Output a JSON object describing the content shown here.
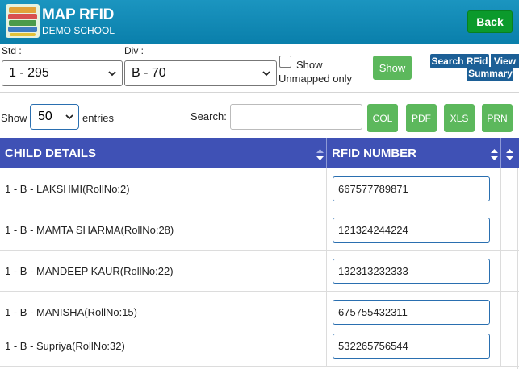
{
  "header": {
    "title": "MAP RFID",
    "subtitle": "DEMO SCHOOL",
    "back_label": "Back",
    "bg_color": "#0e8bb6"
  },
  "filters": {
    "std_label": "Std :",
    "std_value": "1 - 295",
    "div_label": "Div :",
    "div_value": "B - 70",
    "show_unmapped_line1": "Show",
    "show_unmapped_line2": "Unmapped only",
    "show_unmapped_checked": false,
    "show_button": "Show",
    "search_rfid_button": "Search RFid",
    "view_summary_line1": "View",
    "view_summary_line2": "Summary"
  },
  "table_controls": {
    "show_label": "Show",
    "entries_value": "50",
    "entries_label": "entries",
    "search_label": "Search:",
    "search_value": "",
    "buttons": [
      "COL",
      "PDF",
      "XLS",
      "PRN"
    ]
  },
  "table": {
    "headers": [
      "CHILD DETAILS",
      "RFID NUMBER"
    ],
    "header_color": "#3f51b5",
    "rows": [
      {
        "child": "1 - B - LAKSHMI(RollNo:2)",
        "rfid": "667577789871"
      },
      {
        "child": "1 - B - MAMTA SHARMA(RollNo:28)",
        "rfid": "121324244224"
      },
      {
        "child": "1 - B - MANDEEP KAUR(RollNo:22)",
        "rfid": "132313232333"
      },
      {
        "child": "1 - B - MANISHA(RollNo:15)",
        "rfid": "675755432311"
      },
      {
        "child": "1 - B - Supriya(RollNo:32)",
        "rfid": "532265756544"
      }
    ]
  },
  "colors": {
    "accent_green": "#5cb85c",
    "back_green": "#0b9a2c",
    "dark_blue_btn": "#1c5f96"
  },
  "icons": {
    "logo": "books-logo-icon",
    "select_caret": "chevron-down-icon",
    "sort": "sort-arrows-icon"
  }
}
